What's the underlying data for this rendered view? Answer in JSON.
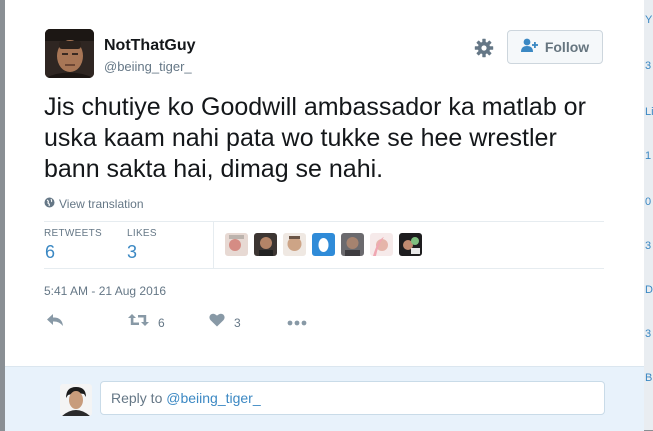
{
  "backdrop": {
    "edge_glyphs": [
      "Y",
      "3",
      "Li",
      "1",
      "0",
      "3",
      "D",
      "3",
      "B"
    ]
  },
  "tweet": {
    "author_name": "NotThatGuy",
    "author_handle": "@beiing_tiger_",
    "follow_label": "Follow",
    "text": "Jis chutiye ko Goodwill ambassador ka matlab or uska kaam nahi pata wo tukke se hee wrestler bann sakta hai, dimag se nahi.",
    "view_translation": "View translation",
    "retweets_label": "RETWEETS",
    "retweets_count": "6",
    "likes_label": "LIKES",
    "likes_count": "3",
    "timestamp": "5:41 AM - 21 Aug 2016",
    "actions": {
      "retweet_count": "6",
      "like_count": "3"
    },
    "likers": [
      "liker-1",
      "liker-2",
      "liker-3",
      "liker-4",
      "liker-5",
      "liker-6",
      "liker-7"
    ]
  },
  "reply": {
    "prefix": "Reply to ",
    "mention": "@beiing_tiger_"
  },
  "colors": {
    "accent": "#3b88c3",
    "muted": "#657786",
    "text": "#14171a",
    "reply_bg": "#e8f2fb"
  }
}
